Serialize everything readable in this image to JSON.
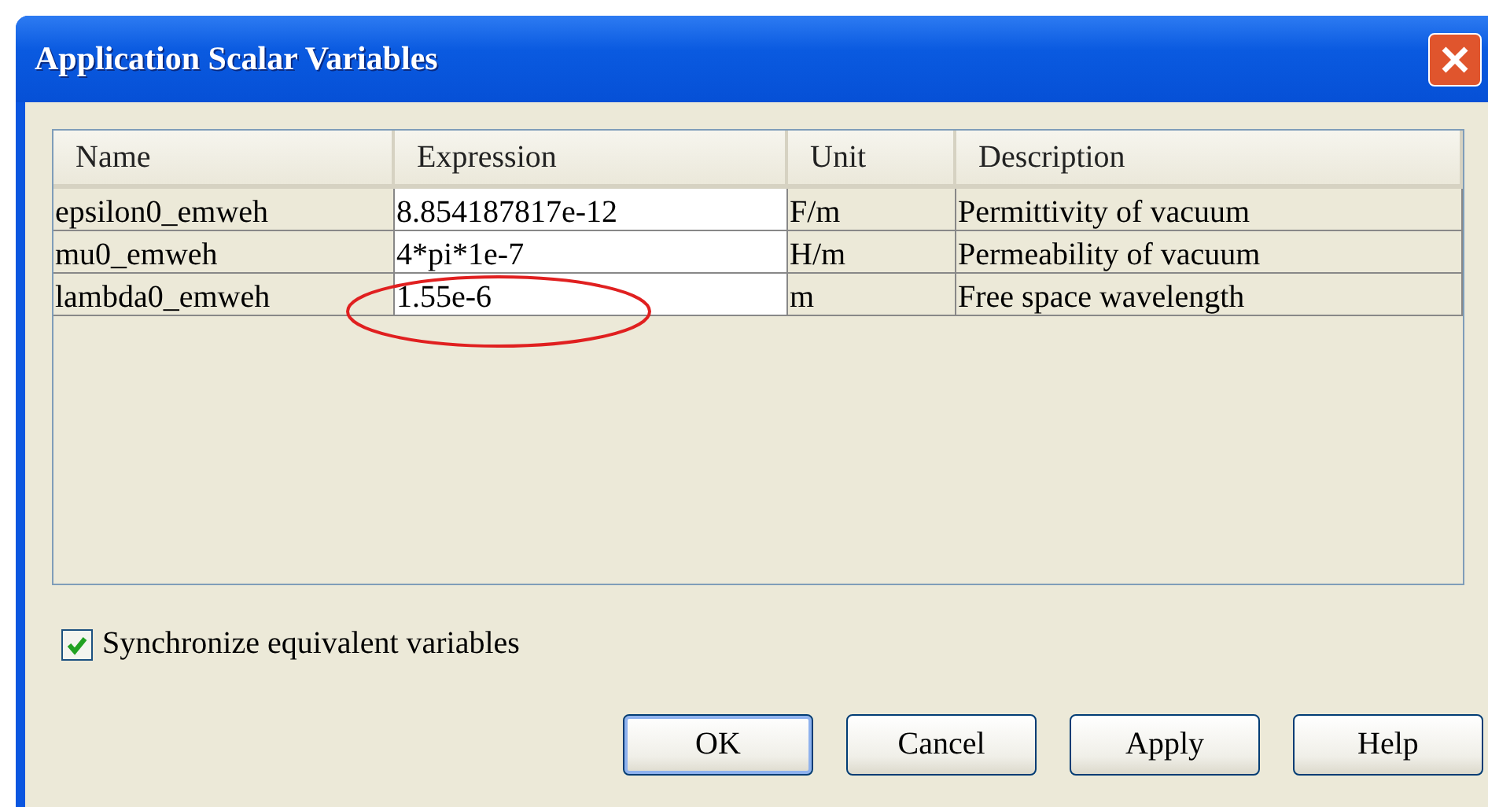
{
  "window": {
    "title": "Application Scalar Variables"
  },
  "table": {
    "columns": [
      "Name",
      "Expression",
      "Unit",
      "Description"
    ],
    "rows": [
      {
        "name": "epsilon0_emweh",
        "expression": "8.854187817e-12",
        "unit": "F/m",
        "description": "Permittivity of vacuum",
        "circled": false
      },
      {
        "name": "mu0_emweh",
        "expression": "4*pi*1e-7",
        "unit": "H/m",
        "description": "Permeability of vacuum",
        "circled": false
      },
      {
        "name": "lambda0_emweh",
        "expression": "1.55e-6",
        "unit": "m",
        "description": "Free space wavelength",
        "circled": true
      }
    ]
  },
  "synchronize": {
    "label": "Synchronize equivalent variables",
    "checked": true
  },
  "buttons": [
    {
      "label": "OK",
      "default": true
    },
    {
      "label": "Cancel",
      "default": false
    },
    {
      "label": "Apply",
      "default": false
    },
    {
      "label": "Help",
      "default": false
    }
  ]
}
